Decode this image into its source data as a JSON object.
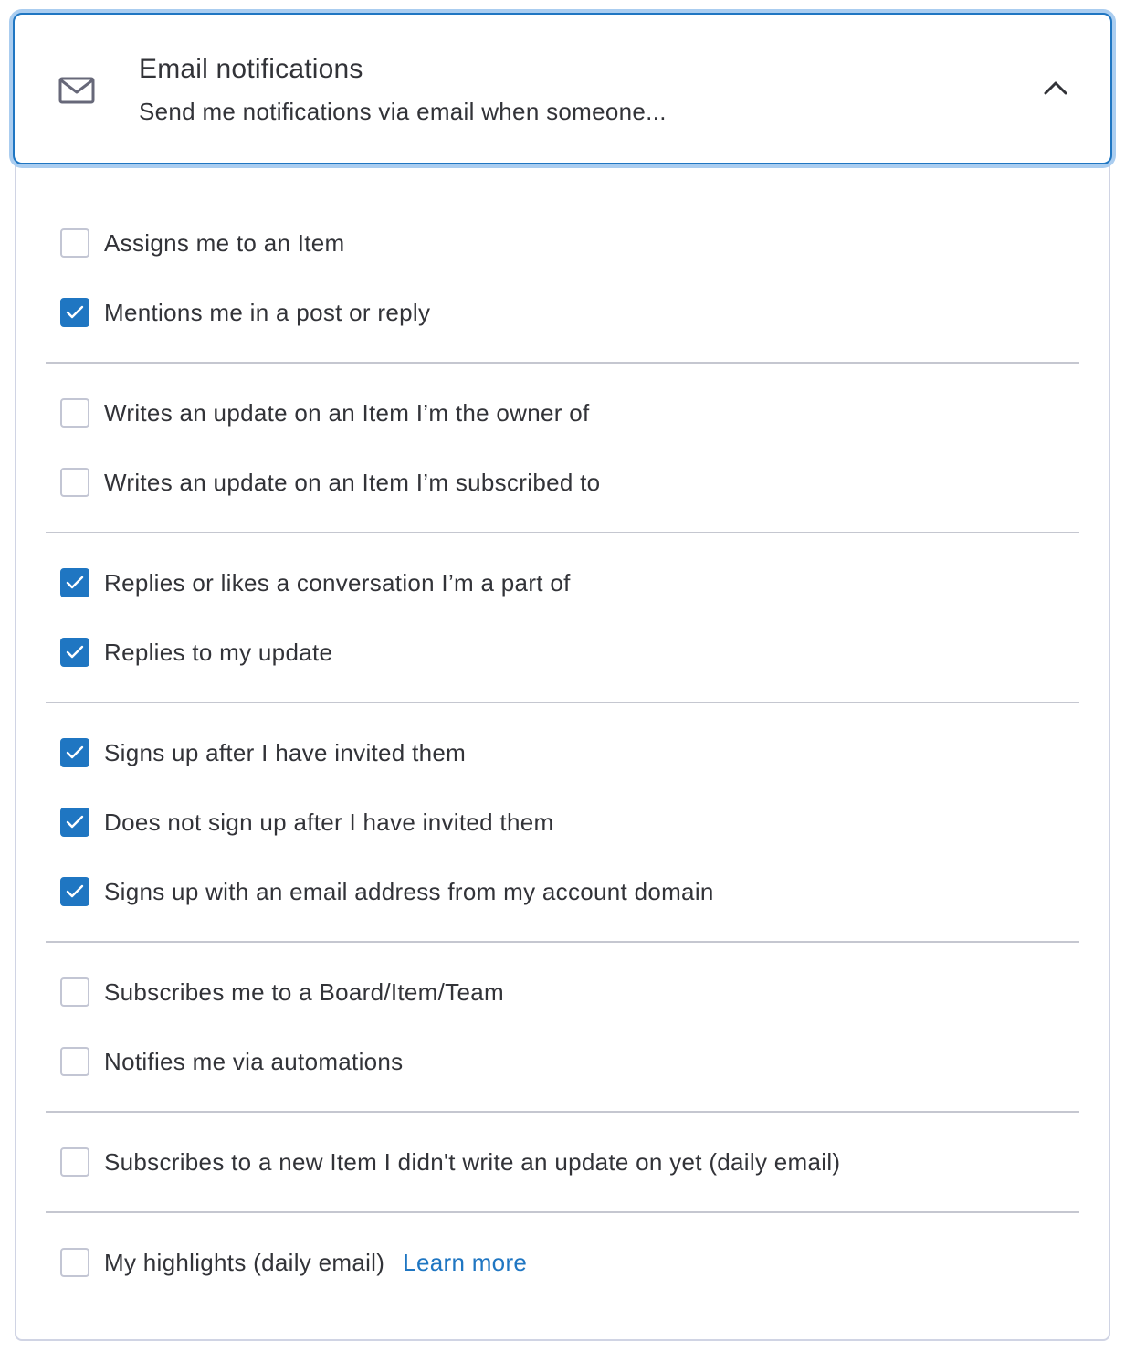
{
  "header": {
    "title": "Email notifications",
    "subtitle": "Send me notifications via email when someone..."
  },
  "groups": [
    [
      {
        "label": "Assigns me to an Item",
        "checked": false
      },
      {
        "label": "Mentions me in a post or reply",
        "checked": true
      }
    ],
    [
      {
        "label": "Writes an update on an Item I’m the owner of",
        "checked": false
      },
      {
        "label": "Writes an update on an Item I’m subscribed to",
        "checked": false
      }
    ],
    [
      {
        "label": "Replies or likes a conversation I’m a part of",
        "checked": true
      },
      {
        "label": "Replies to my update",
        "checked": true
      }
    ],
    [
      {
        "label": "Signs up after I have invited them",
        "checked": true
      },
      {
        "label": "Does not sign up after I have invited them",
        "checked": true
      },
      {
        "label": "Signs up with an email address from my account domain",
        "checked": true
      }
    ],
    [
      {
        "label": "Subscribes me to a Board/Item/Team",
        "checked": false
      },
      {
        "label": "Notifies me via automations",
        "checked": false
      }
    ],
    [
      {
        "label": "Subscribes to a new Item I didn't write an update on yet (daily email)",
        "checked": false
      }
    ],
    [
      {
        "label": "My highlights (daily email)",
        "checked": false,
        "link": "Learn more"
      }
    ]
  ],
  "colors": {
    "accent": "#1f76c2",
    "text": "#323338",
    "border": "#d0d4e4",
    "divider": "#c5c7d0"
  },
  "icons": {
    "header": "mail-icon",
    "toggle": "chevron-up-icon",
    "check": "check-icon"
  }
}
